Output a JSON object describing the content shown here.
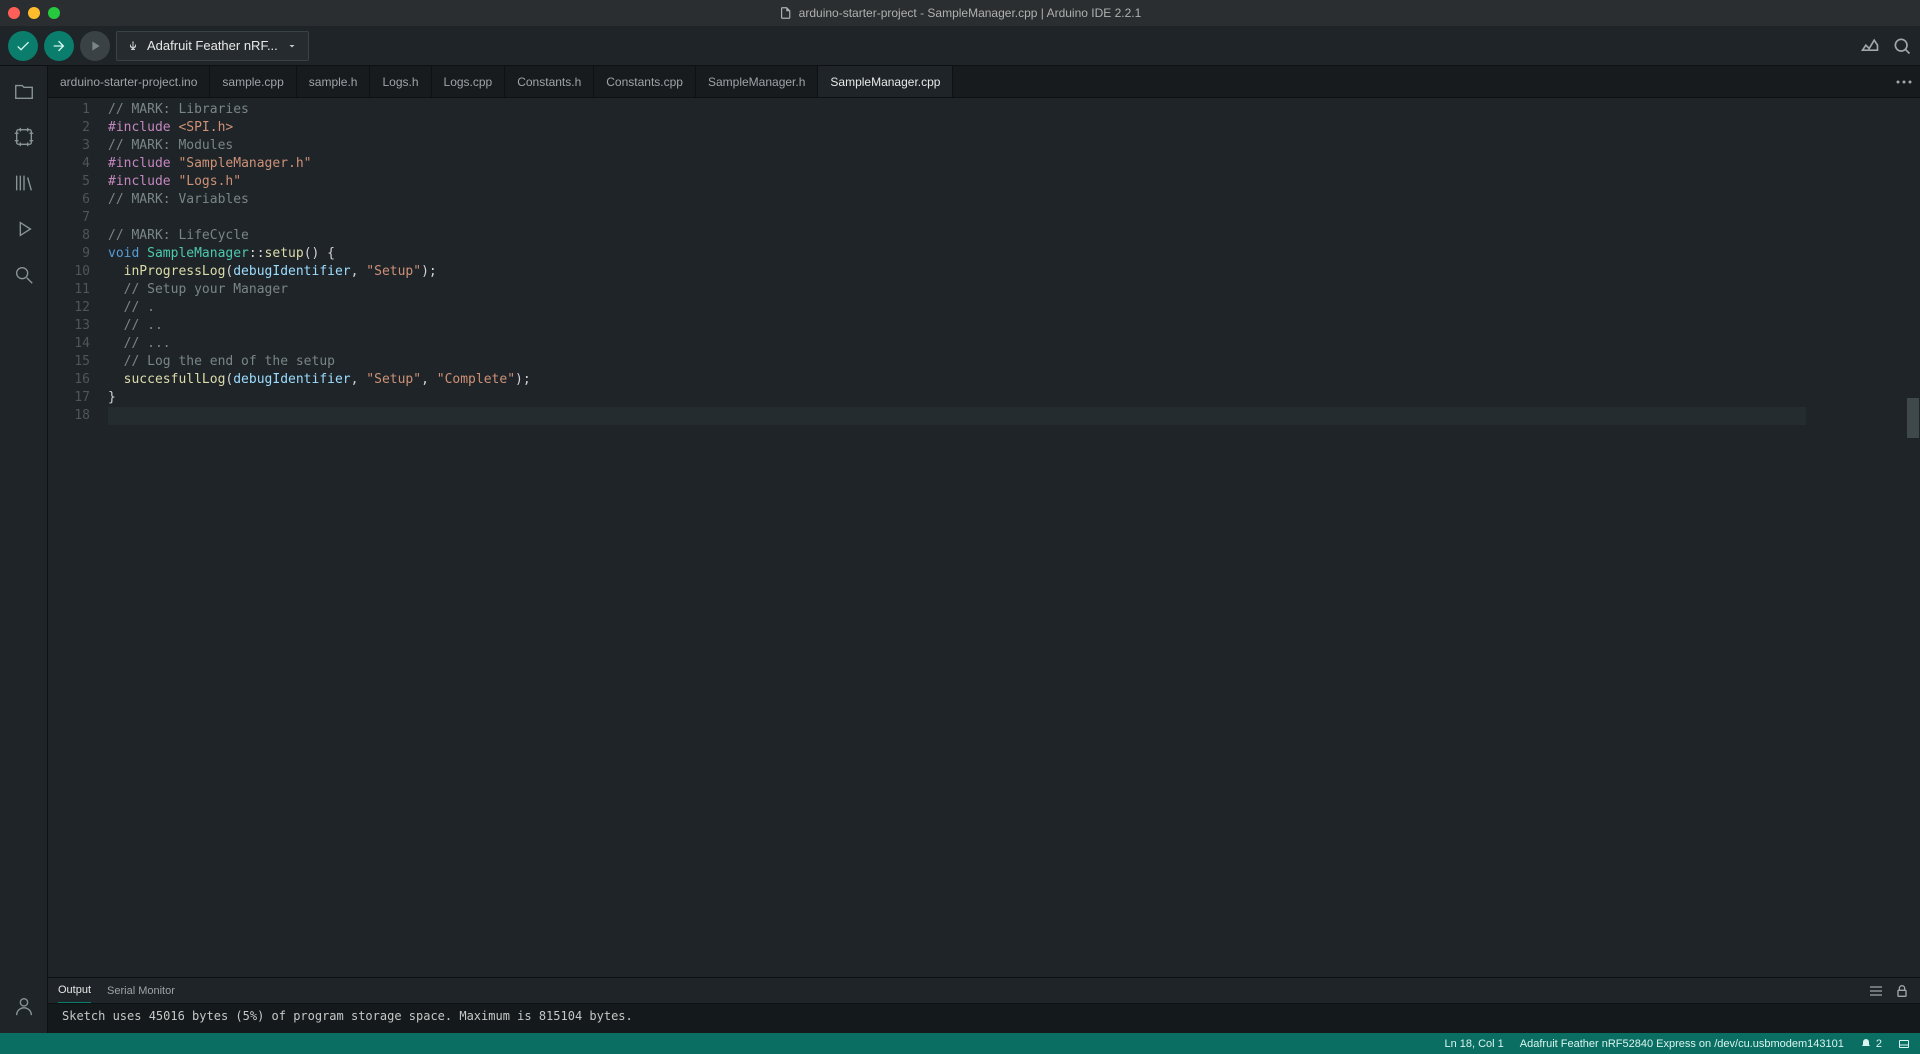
{
  "window": {
    "title": "arduino-starter-project - SampleManager.cpp | Arduino IDE 2.2.1"
  },
  "toolbar": {
    "board_label": "Adafruit Feather nRF..."
  },
  "tabs": [
    {
      "label": "arduino-starter-project.ino",
      "active": false
    },
    {
      "label": "sample.cpp",
      "active": false
    },
    {
      "label": "sample.h",
      "active": false
    },
    {
      "label": "Logs.h",
      "active": false
    },
    {
      "label": "Logs.cpp",
      "active": false
    },
    {
      "label": "Constants.h",
      "active": false
    },
    {
      "label": "Constants.cpp",
      "active": false
    },
    {
      "label": "SampleManager.h",
      "active": false
    },
    {
      "label": "SampleManager.cpp",
      "active": true
    }
  ],
  "code": {
    "lines": [
      [
        {
          "t": "// MARK: Libraries",
          "c": "tok-comment"
        }
      ],
      [
        {
          "t": "#include",
          "c": "tok-pre"
        },
        {
          "t": " ",
          "c": ""
        },
        {
          "t": "<SPI.h>",
          "c": "tok-str"
        }
      ],
      [
        {
          "t": "// MARK: Modules",
          "c": "tok-comment"
        }
      ],
      [
        {
          "t": "#include",
          "c": "tok-pre"
        },
        {
          "t": " ",
          "c": ""
        },
        {
          "t": "\"SampleManager.h\"",
          "c": "tok-str"
        }
      ],
      [
        {
          "t": "#include",
          "c": "tok-pre"
        },
        {
          "t": " ",
          "c": ""
        },
        {
          "t": "\"Logs.h\"",
          "c": "tok-str"
        }
      ],
      [
        {
          "t": "// MARK: Variables",
          "c": "tok-comment"
        }
      ],
      [
        {
          "t": "",
          "c": ""
        }
      ],
      [
        {
          "t": "// MARK: LifeCycle",
          "c": "tok-comment"
        }
      ],
      [
        {
          "t": "void",
          "c": "tok-kw"
        },
        {
          "t": " ",
          "c": ""
        },
        {
          "t": "SampleManager",
          "c": "tok-type"
        },
        {
          "t": "::",
          "c": "tok-punc"
        },
        {
          "t": "setup",
          "c": "tok-fn"
        },
        {
          "t": "() {",
          "c": "tok-punc"
        }
      ],
      [
        {
          "t": "  ",
          "c": ""
        },
        {
          "t": "inProgressLog",
          "c": "tok-fn"
        },
        {
          "t": "(",
          "c": "tok-punc"
        },
        {
          "t": "debugIdentifier",
          "c": "tok-var"
        },
        {
          "t": ", ",
          "c": "tok-punc"
        },
        {
          "t": "\"Setup\"",
          "c": "tok-str"
        },
        {
          "t": ");",
          "c": "tok-punc"
        }
      ],
      [
        {
          "t": "  ",
          "c": ""
        },
        {
          "t": "// Setup your Manager",
          "c": "tok-comment"
        }
      ],
      [
        {
          "t": "  ",
          "c": ""
        },
        {
          "t": "// .",
          "c": "tok-comment"
        }
      ],
      [
        {
          "t": "  ",
          "c": ""
        },
        {
          "t": "// ..",
          "c": "tok-comment"
        }
      ],
      [
        {
          "t": "  ",
          "c": ""
        },
        {
          "t": "// ...",
          "c": "tok-comment"
        }
      ],
      [
        {
          "t": "  ",
          "c": ""
        },
        {
          "t": "// Log the end of the setup",
          "c": "tok-comment"
        }
      ],
      [
        {
          "t": "  ",
          "c": ""
        },
        {
          "t": "succesfullLog",
          "c": "tok-fn"
        },
        {
          "t": "(",
          "c": "tok-punc"
        },
        {
          "t": "debugIdentifier",
          "c": "tok-var"
        },
        {
          "t": ", ",
          "c": "tok-punc"
        },
        {
          "t": "\"Setup\"",
          "c": "tok-str"
        },
        {
          "t": ", ",
          "c": "tok-punc"
        },
        {
          "t": "\"Complete\"",
          "c": "tok-str"
        },
        {
          "t": ");",
          "c": "tok-punc"
        }
      ],
      [
        {
          "t": "}",
          "c": "tok-punc"
        }
      ],
      [
        {
          "t": "",
          "c": ""
        }
      ]
    ],
    "active_line": 18
  },
  "panel": {
    "tabs": [
      {
        "label": "Output",
        "active": true
      },
      {
        "label": "Serial Monitor",
        "active": false
      }
    ],
    "output": "Sketch uses 45016 bytes (5%) of program storage space. Maximum is 815104 bytes."
  },
  "status": {
    "cursor": "Ln 18, Col 1",
    "board": "Adafruit Feather nRF52840 Express on /dev/cu.usbmodem143101",
    "notif_count": "2"
  }
}
